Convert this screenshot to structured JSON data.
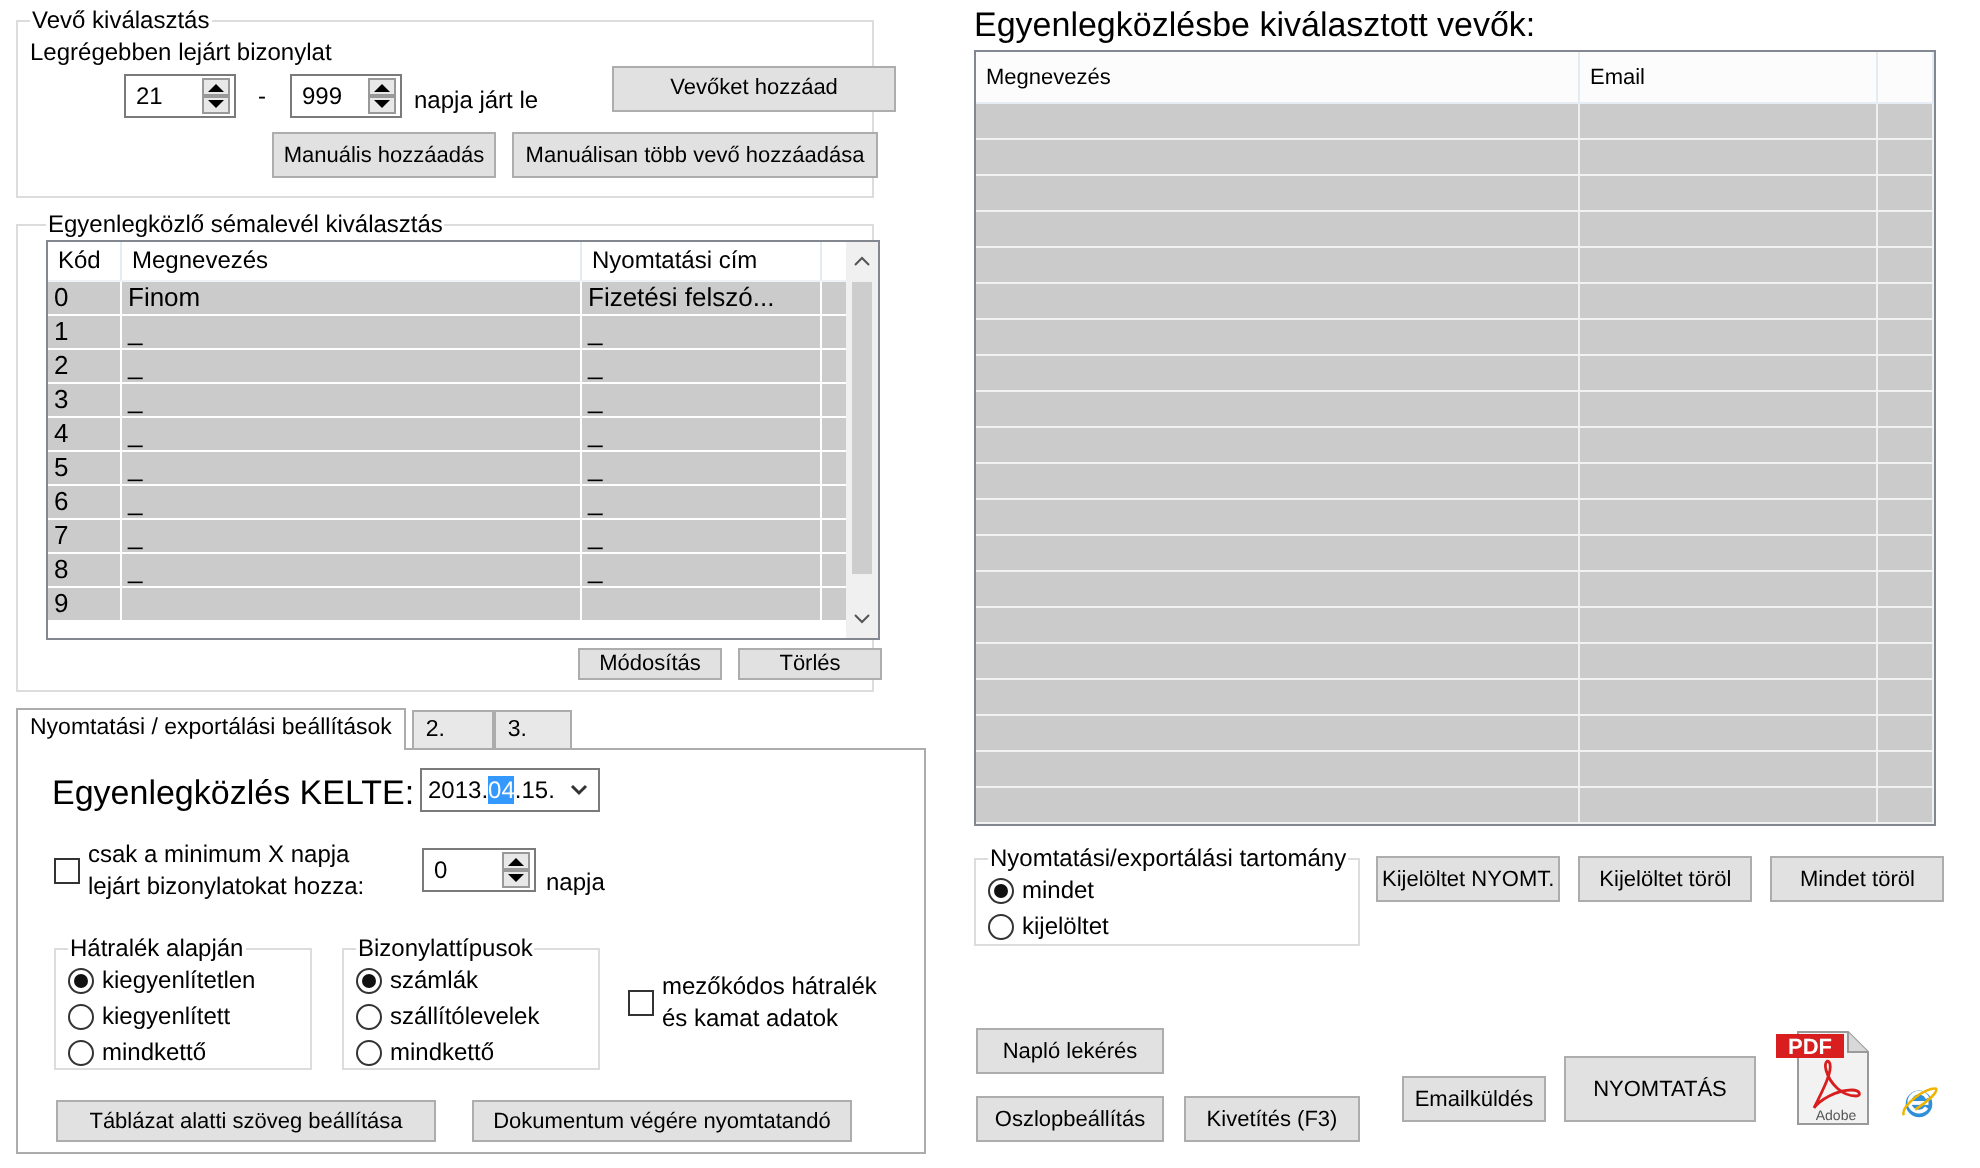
{
  "customer_selection": {
    "title": "Vevő kiválasztás",
    "oldest_label": "Legrégebben lejárt bizonylat",
    "from_days": "21",
    "separator": "-",
    "to_days": "999",
    "days_suffix": "napja járt le",
    "add_button": "Vevőket hozzáad",
    "manual_buttons": [
      "Manuális hozzáadás",
      "Manuálisan több vevő hozzáadása"
    ]
  },
  "template_selection": {
    "title": "Egyenlegközlő sémalevél kiválasztás",
    "columns": [
      "Kód",
      "Megnevezés",
      "Nyomtatási cím"
    ],
    "rows": [
      {
        "code": "0",
        "name": "Finom",
        "print_title": "Fizetési felszó..."
      },
      {
        "code": "1",
        "name": "_",
        "print_title": "_"
      },
      {
        "code": "2",
        "name": "_",
        "print_title": "_"
      },
      {
        "code": "3",
        "name": "_",
        "print_title": "_"
      },
      {
        "code": "4",
        "name": "_",
        "print_title": "_"
      },
      {
        "code": "5",
        "name": "_",
        "print_title": "_"
      },
      {
        "code": "6",
        "name": "_",
        "print_title": "_"
      },
      {
        "code": "7",
        "name": "_",
        "print_title": "_"
      },
      {
        "code": "8",
        "name": "_",
        "print_title": "_"
      },
      {
        "code": "9"
      }
    ],
    "buttons": [
      "Módosítás",
      "Törlés"
    ]
  },
  "tabs": [
    {
      "label": "Nyomtatási / exportálási beállítások",
      "selected": true
    },
    {
      "label": "2.",
      "selected": false
    },
    {
      "label": "3.",
      "selected": false
    }
  ],
  "settings": {
    "date_label": "Egyenlegközlés KELTE:",
    "date": {
      "prefix": "2013.",
      "selection": "04",
      "suffix": ".15."
    },
    "min_days": {
      "checked": false,
      "label": "csak a minimum X napja lejárt bizonylatokat hozza:",
      "value": "0",
      "suffix": "napja"
    },
    "arrears": {
      "title": "Hátralék alapján",
      "options": [
        {
          "label": "kiegyenlítetlen",
          "selected": true
        },
        {
          "label": "kiegyenlített",
          "selected": false
        },
        {
          "label": "mindkettő",
          "selected": false
        }
      ]
    },
    "document_types": {
      "title": "Bizonylattípusok",
      "options": [
        {
          "label": "számlák",
          "selected": true
        },
        {
          "label": "szállítólevelek",
          "selected": false
        },
        {
          "label": "mindkettő",
          "selected": false
        }
      ]
    },
    "field_code": {
      "checked": false,
      "label": "mezőkódos hátralék és kamat adatok"
    },
    "buttons": [
      "Táblázat alatti szöveg beállítása",
      "Dokumentum végére nyomtatandó"
    ]
  },
  "selected_customers": {
    "title": "Egyenlegközlésbe kiválasztott vevők:",
    "columns": [
      "Megnevezés",
      "Email"
    ]
  },
  "range": {
    "title": "Nyomtatási/exportálási tartomány",
    "options": [
      {
        "label": "mindet",
        "selected": true
      },
      {
        "label": "kijelöltet",
        "selected": false
      }
    ]
  },
  "range_buttons": [
    "Kijelöltet NYOMT.",
    "Kijelöltet töröl",
    "Mindet töröl"
  ],
  "log_button": "Napló lekérés",
  "bottom_buttons": [
    "Oszlopbeállítás",
    "Kivetítés (F3)",
    "Emailküldés"
  ],
  "print_button": "NYOMTATÁS",
  "pdf_icon": {
    "badge": "PDF",
    "brand": "Adobe"
  }
}
